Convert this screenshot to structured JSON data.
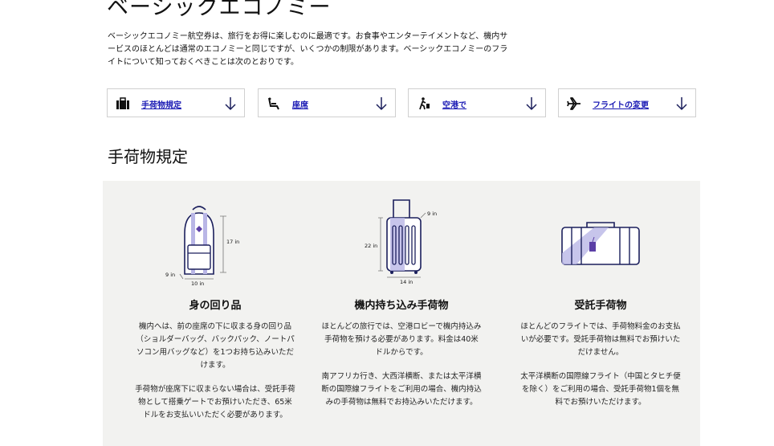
{
  "page": {
    "title": "ベーシックエコノミー",
    "intro": "ベーシックエコノミー航空券は、旅行をお得に楽しむのに最適です。お食事やエンターテイメントなど、機内サービスのほとんどは通常のエコノミーと同じですが、いくつかの制限があります。ベーシックエコノミーのフライトについて知っておくべきことは次のとおりです。"
  },
  "quick_links": [
    {
      "label": "手荷物規定",
      "icon": "luggage-icon"
    },
    {
      "label": "座席",
      "icon": "seat-icon"
    },
    {
      "label": "空港で",
      "icon": "traveler-icon"
    },
    {
      "label": "フライトの変更",
      "icon": "airplane-icon"
    }
  ],
  "baggage": {
    "heading": "手荷物規定",
    "personal_item": {
      "title": "身の回り品",
      "paragraphs": [
        "機内へは、前の座席の下に収まる身の回り品（ショルダーバッグ、バックパック、ノートパソコン用バッグなど）を1つお持ち込みいただけます。",
        "手荷物が座席下に収まらない場合は、受託手荷物として搭乗ゲートでお預けいただき、65米ドルをお支払いいただく必要があります。"
      ],
      "dims": {
        "height": "17 in",
        "depth": "9 in",
        "width": "10 in"
      }
    },
    "carry_on": {
      "title": "機内持ち込み手荷物",
      "paragraphs": [
        "ほとんどの旅行では、空港ロビーで機内持込み手荷物を預ける必要があります。料金は40米ドルからです。",
        "南アフリカ行き、大西洋横断、または太平洋横断の国際線フライトをご利用の場合、機内持込みの手荷物は無料でお持込みいただけます。"
      ],
      "dims": {
        "depth": "9 in",
        "height": "22 in",
        "width": "14 in"
      }
    },
    "checked": {
      "title": "受託手荷物",
      "paragraphs": [
        "ほとんどのフライトでは、手荷物料金のお支払いが必要です。受託手荷物は無料でお預けいただけません。",
        "太平洋横断の国際線フライト（中国とタヒチ便を除く）をご利用の場合、受託手荷物1個を無料でお預けいただけます。"
      ]
    }
  },
  "colors": {
    "link": "#1a1ab4",
    "navy": "#1b1f5c",
    "lavender": "#b9b6e6",
    "purple": "#5b3fa6",
    "panel": "#f2f2f0"
  }
}
